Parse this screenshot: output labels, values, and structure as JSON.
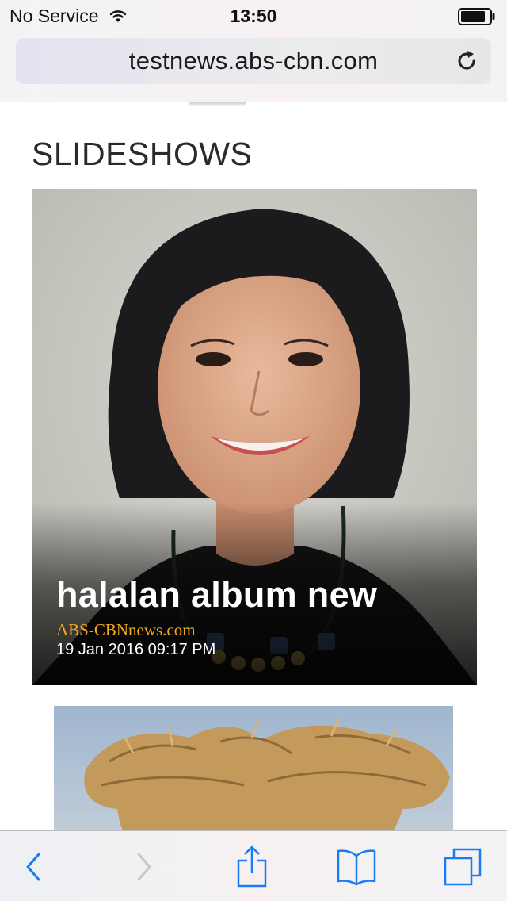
{
  "status_bar": {
    "carrier": "No Service",
    "time": "13:50",
    "wifi_icon": "wifi-icon",
    "battery_icon": "battery-icon"
  },
  "browser": {
    "url": "testnews.abs-cbn.com",
    "reload_icon": "reload-icon"
  },
  "page": {
    "section_title": "SLIDESHOWS",
    "cards": [
      {
        "title": "halalan album new",
        "source": "ABS-CBNnews.com",
        "date": "19 Jan 2016 09:17 PM"
      }
    ]
  },
  "toolbar": {
    "items": [
      {
        "icon": "back-chevron-icon",
        "enabled": true
      },
      {
        "icon": "forward-chevron-icon",
        "enabled": false
      },
      {
        "icon": "share-icon",
        "enabled": true
      },
      {
        "icon": "bookmarks-icon",
        "enabled": true
      },
      {
        "icon": "tabs-icon",
        "enabled": true
      }
    ]
  },
  "colors": {
    "ios_blue": "#1a7cf5",
    "disabled_gray": "#c7c7cc",
    "source_orange": "#f0a81e"
  }
}
